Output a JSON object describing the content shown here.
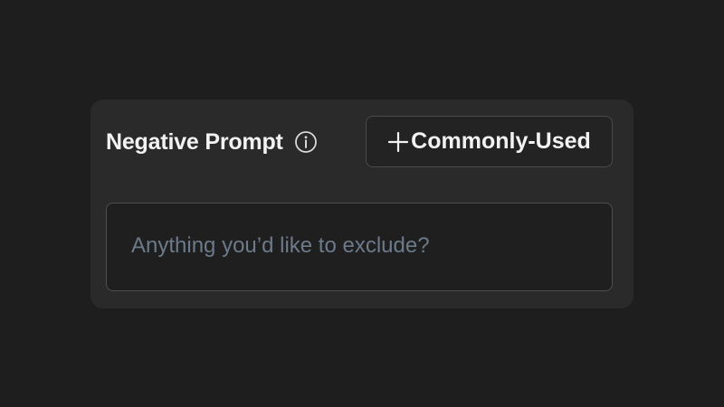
{
  "negative_prompt": {
    "title": "Negative Prompt",
    "info_icon": "info-circle-icon",
    "common_button": {
      "icon": "plus-icon",
      "label": "Commonly-Used"
    },
    "input": {
      "value": "",
      "placeholder": "Anything you’d like to exclude?"
    }
  },
  "colors": {
    "page_background": "#1e1e1e",
    "panel_background": "#2a2a2a",
    "text": "#f2f2f2",
    "placeholder": "#6c7a8a",
    "border": "#4a4a4a"
  }
}
